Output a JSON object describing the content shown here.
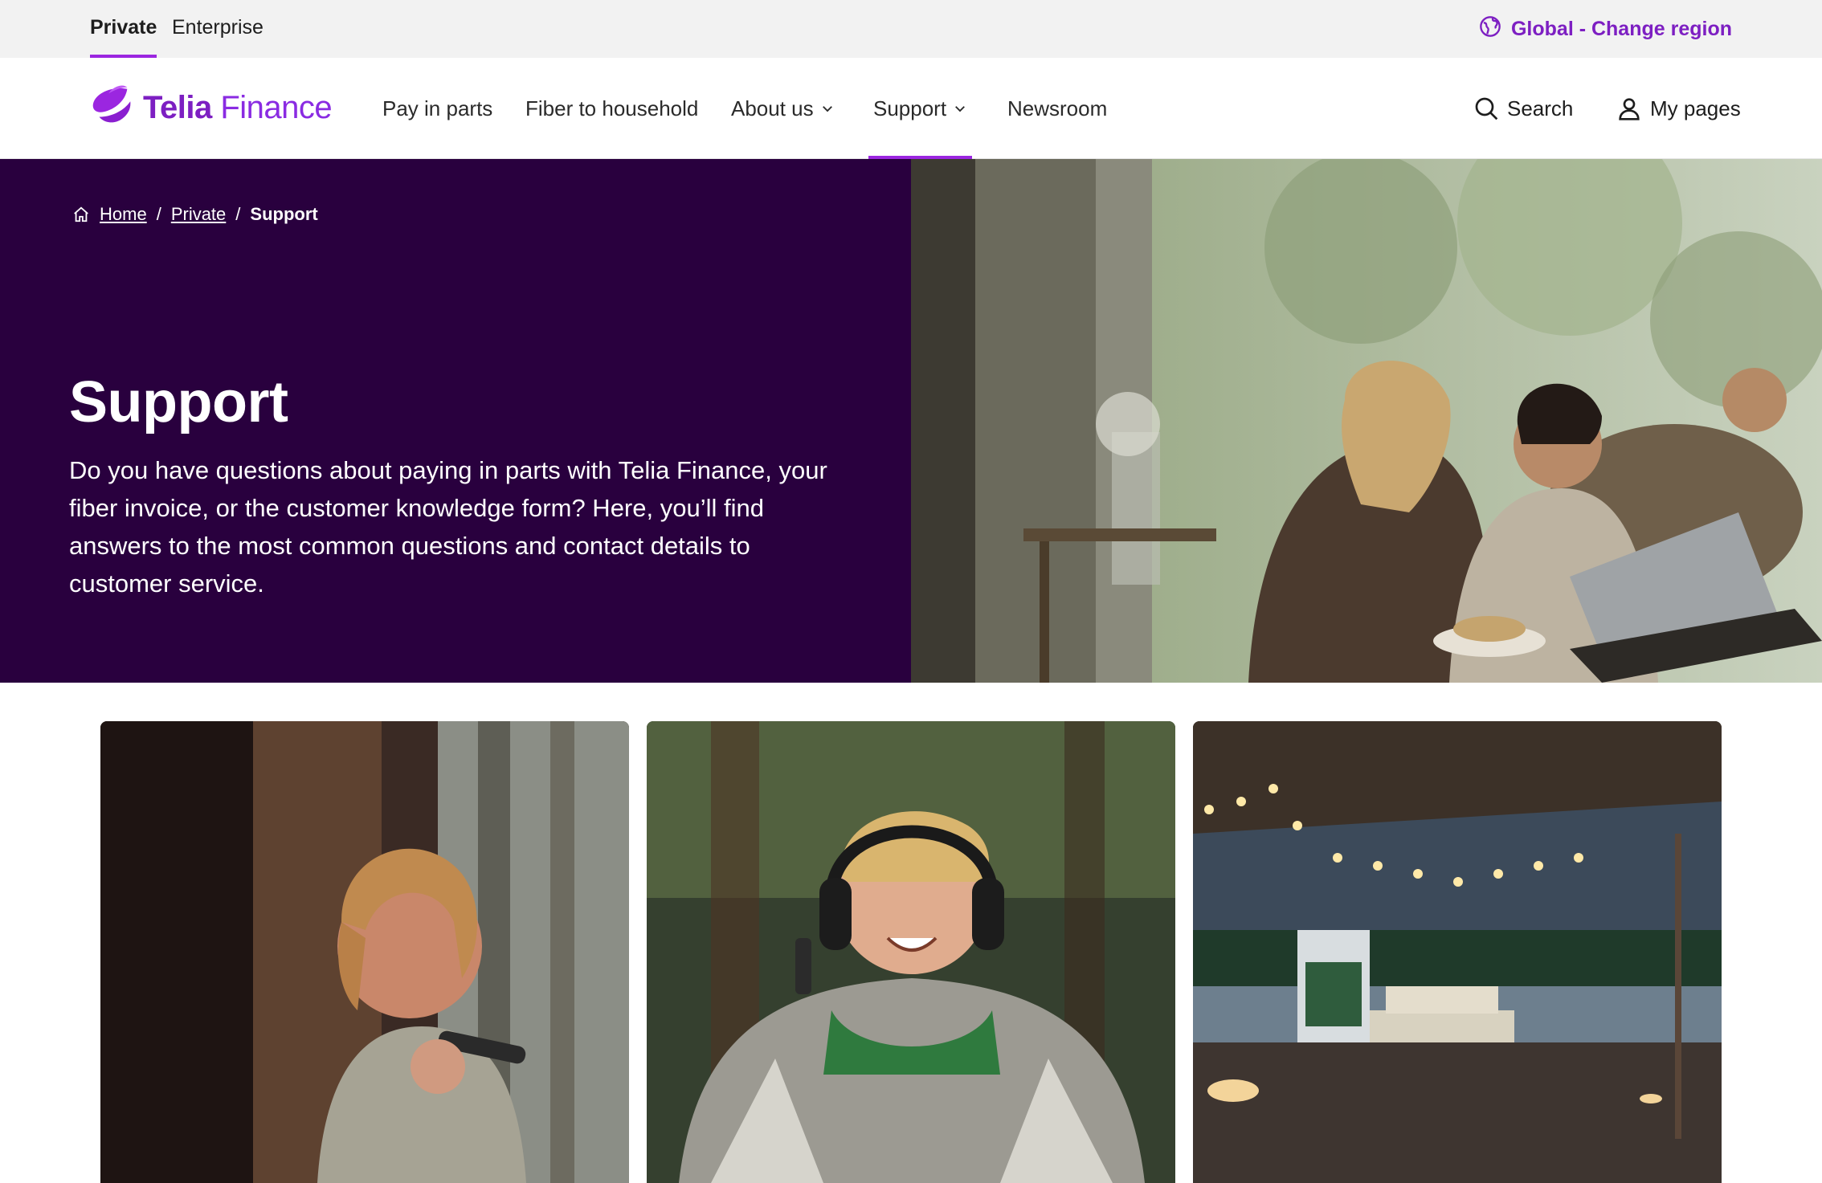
{
  "topbar": {
    "tabs": [
      {
        "label": "Private",
        "active": true
      },
      {
        "label": "Enterprise",
        "active": false
      }
    ],
    "region_label": "Global - Change region",
    "region_icon": "globe-icon"
  },
  "header": {
    "logo": {
      "brand": "Telia",
      "product": "Finance"
    },
    "nav": [
      {
        "label": "Pay in parts",
        "has_dropdown": false
      },
      {
        "label": "Fiber to household",
        "has_dropdown": false
      },
      {
        "label": "About us",
        "has_dropdown": true
      },
      {
        "label": "Support",
        "has_dropdown": true,
        "active": true
      },
      {
        "label": "Newsroom",
        "has_dropdown": false
      }
    ],
    "search_label": "Search",
    "mypages_label": "My pages"
  },
  "hero": {
    "breadcrumb": {
      "home": "Home",
      "private": "Private",
      "current": "Support",
      "separator": "/"
    },
    "title": "Support",
    "description": "Do you have questions about paying in parts with Telia Finance, your fiber invoice, or the customer knowledge form? Here, you’ll find answers to the most common questions and contact details to customer service."
  },
  "colors": {
    "accent": "#9b26e0",
    "brand_purple": "#7d1fc2",
    "hero_bg": "#29003e",
    "topbar_bg": "#f2f2f2"
  }
}
